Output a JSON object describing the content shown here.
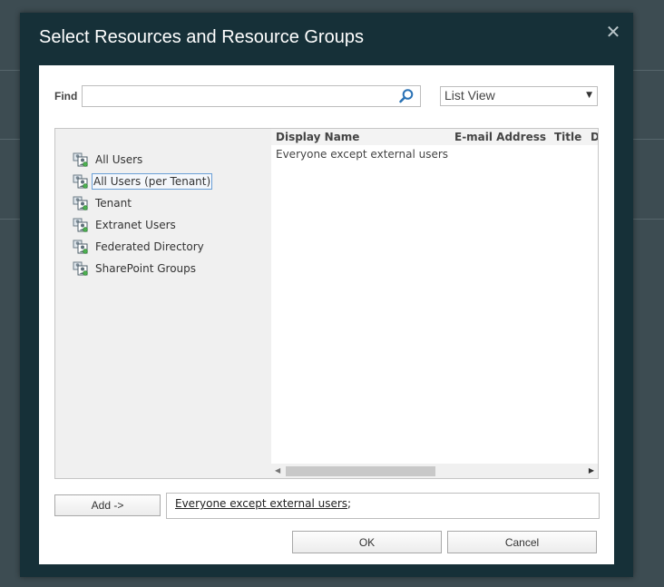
{
  "dialog": {
    "title": "Select Resources and Resource Groups",
    "close_icon": "close-icon",
    "close_glyph": "✕"
  },
  "find": {
    "label": "Find",
    "value": "",
    "placeholder": "",
    "icon": "search-icon"
  },
  "view_select": {
    "value": "List View",
    "arrow": "▼"
  },
  "tree": {
    "items": [
      {
        "label": "All Users",
        "icon": "users-group-icon",
        "selected": false
      },
      {
        "label": "All Users (per Tenant)",
        "icon": "users-group-icon",
        "selected": true
      },
      {
        "label": "Tenant",
        "icon": "users-group-icon",
        "selected": false
      },
      {
        "label": "Extranet Users",
        "icon": "users-group-icon",
        "selected": false
      },
      {
        "label": "Federated Directory",
        "icon": "users-group-icon",
        "selected": false
      },
      {
        "label": "SharePoint Groups",
        "icon": "users-group-icon",
        "selected": false
      }
    ]
  },
  "results": {
    "columns": [
      "Display Name",
      "E-mail Address",
      "Title",
      "D"
    ],
    "rows": [
      [
        "Everyone except external users",
        "",
        "",
        ""
      ]
    ],
    "scroll_left": "◀",
    "scroll_right": "▶"
  },
  "add": {
    "label": "Add ->"
  },
  "selected": {
    "entry_name": "Everyone except external users",
    "separator": ";"
  },
  "footer": {
    "ok_label": "OK",
    "cancel_label": "Cancel"
  },
  "colors": {
    "dialog_bg": "#163038",
    "page_bg": "#3d4c52",
    "panel_bg": "#f0f0f0",
    "selected_border": "#6a9fd6"
  }
}
